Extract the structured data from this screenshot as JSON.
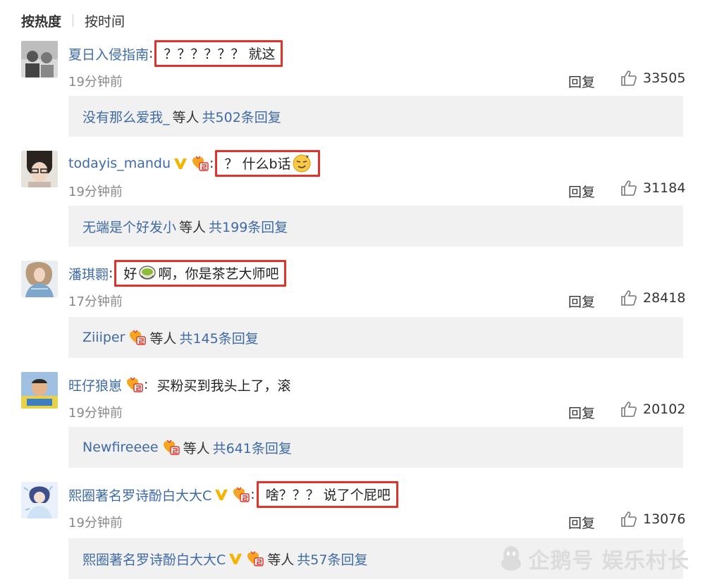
{
  "sort": {
    "active": "按热度",
    "other": "按时间"
  },
  "reply_label": "回复",
  "others_label": "等人",
  "comments": [
    {
      "user": "夏日入侵指南",
      "text": "？？？？？？ 就这",
      "time": "19分钟前",
      "likes": "33505",
      "sub_user": "没有那么爱我_",
      "sub_count": "共502条回复"
    },
    {
      "user": "todayis_mandu",
      "text": "？ 什么b话",
      "time": "19分钟前",
      "likes": "31184",
      "sub_user": "无端是个好发小",
      "sub_count": "共199条回复"
    },
    {
      "user": "潘琪翾",
      "text_a": "好",
      "text_b": "啊，你是茶艺大师吧",
      "time": "17分钟前",
      "likes": "28418",
      "sub_user": "Ziiiper",
      "sub_count": "共145条回复"
    },
    {
      "user": "旺仔狼崽",
      "text": "买粉买到我头上了，滚",
      "time": "19分钟前",
      "likes": "20102",
      "sub_user": "Newfireeee",
      "sub_count": "共641条回复"
    },
    {
      "user": "熙圈著名罗诗酚白大大C",
      "text": "啥？？？ 说了个屁吧",
      "time": "19分钟前",
      "likes": "13076",
      "sub_user": "熙圈著名罗诗酚白大大C",
      "sub_count": "共57条回复"
    }
  ],
  "watermark": "企鹅号 娱乐村长",
  "colors": {
    "link": "#3e6aa6",
    "highlight": "#e0332b",
    "subbg": "#f1f1f1"
  }
}
